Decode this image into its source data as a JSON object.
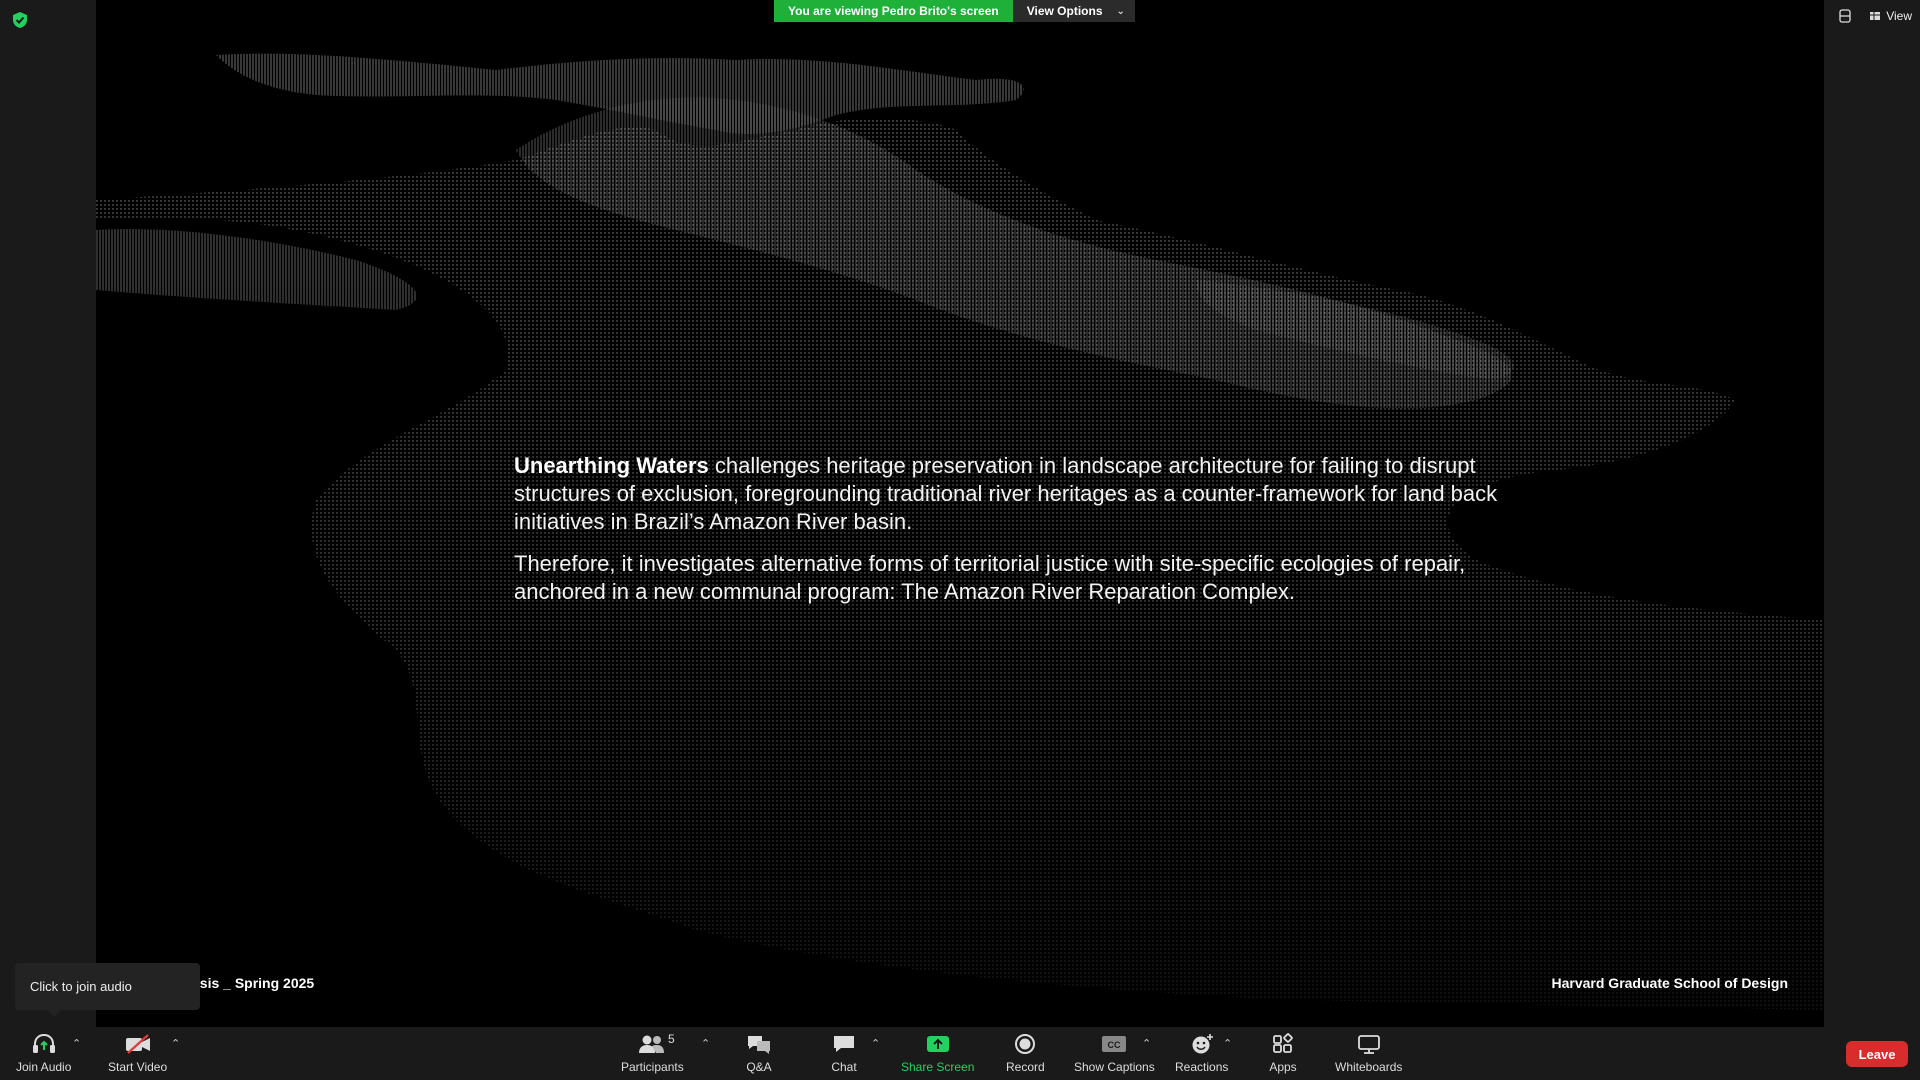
{
  "banner": {
    "viewing_text": "You are viewing Pedro Brito's screen",
    "view_options": "View Options"
  },
  "top_right": {
    "view_label": "View"
  },
  "slide": {
    "title_bold": "Unearthing Waters",
    "paragraph1_rest": " challenges heritage preservation in landscape architecture for failing to disrupt structures of exclusion, foregrounding traditional river heritages as a counter-framework for land back initiatives in Brazil’s Amazon River basin.",
    "paragraph2": "Therefore, it investigates alternative forms of territorial justice with site-specific ecologies of repair, anchored in a new communal program: The Amazon River Reparation Complex.",
    "footer_left": "esis _ Spring 2025",
    "footer_right": "Harvard Graduate School of Design"
  },
  "tooltip": {
    "text": "Click to join audio"
  },
  "toolbar": {
    "join_audio": "Join Audio",
    "start_video": "Start Video",
    "participants": "Participants",
    "participants_count": "5",
    "qa": "Q&A",
    "chat": "Chat",
    "share_screen": "Share Screen",
    "record": "Record",
    "show_captions": "Show Captions",
    "reactions": "Reactions",
    "apps": "Apps",
    "whiteboards": "Whiteboards",
    "leave": "Leave"
  },
  "colors": {
    "accent_green": "#1fb03a",
    "leave_red": "#d92c2c",
    "share_green": "#23d160"
  },
  "icons": [
    "shield-icon",
    "headphones-icon",
    "video-off-icon",
    "participants-icon",
    "qa-icon",
    "chat-icon",
    "share-screen-icon",
    "record-icon",
    "captions-icon",
    "reactions-icon",
    "apps-icon",
    "whiteboard-icon",
    "view-icon",
    "layout-icon",
    "chevron-up-icon",
    "chevron-down-icon"
  ]
}
